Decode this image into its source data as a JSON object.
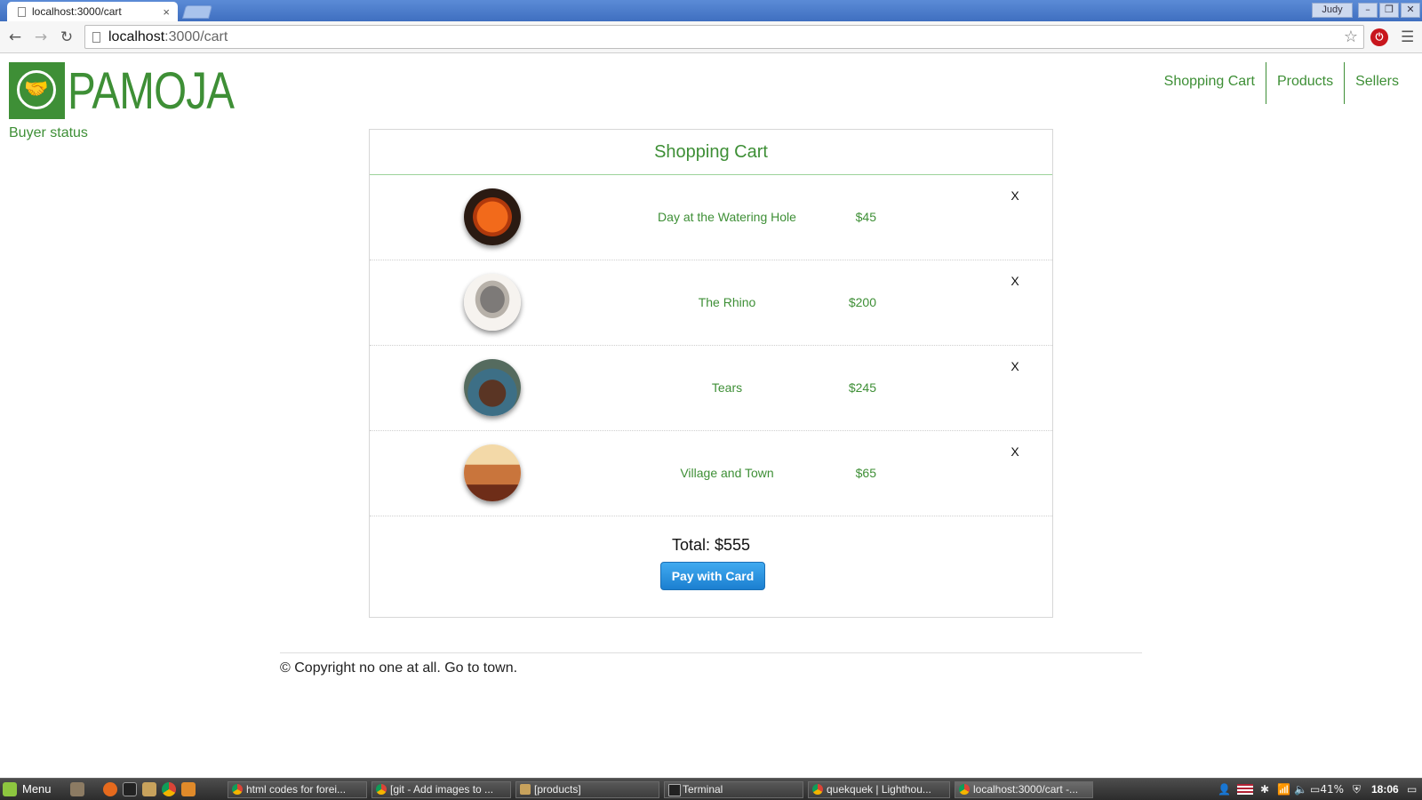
{
  "browser": {
    "tab_title": "localhost:3000/cart",
    "tab_close": "×",
    "url_host": "localhost",
    "url_path": ":3000/cart",
    "user_label": "Judy",
    "window_buttons": [
      "–",
      "❐",
      "✕"
    ]
  },
  "site": {
    "logo_text": "PAMOJA",
    "buyer_status": "Buyer status",
    "nav": [
      "Shopping Cart",
      "Products",
      "Sellers"
    ]
  },
  "cart": {
    "title": "Shopping Cart",
    "remove_label": "X",
    "items": [
      {
        "name": "Day at the Watering Hole",
        "price": "$45"
      },
      {
        "name": "The Rhino",
        "price": "$200"
      },
      {
        "name": "Tears",
        "price": "$245"
      },
      {
        "name": "Village and Town",
        "price": "$65"
      }
    ],
    "total": "Total: $555",
    "pay_button": "Pay with Card"
  },
  "footer": {
    "text": "© Copyright no one at all. Go to town."
  },
  "taskbar": {
    "start_label": "Menu",
    "tasks": [
      "html codes for forei...",
      "[git - Add images to ...",
      "[products]",
      "Terminal",
      "quekquek | Lighthou...",
      "localhost:3000/cart -..."
    ],
    "battery": "41%",
    "clock": "18:06"
  },
  "colors": {
    "brand_green": "#3e8f36",
    "pay_blue": "#1b7fd0",
    "chrome_blue": "#4a7ccb"
  }
}
